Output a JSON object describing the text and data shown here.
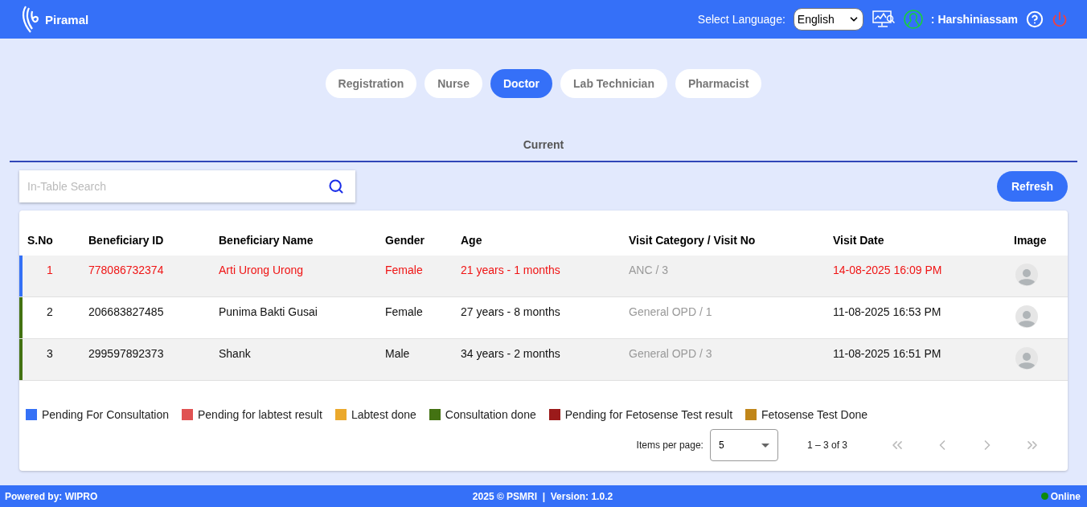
{
  "header": {
    "brand": "Piramal",
    "language_label": "Select Language:",
    "language": "English",
    "user_prefix": ":",
    "username": "Harshiniassam"
  },
  "role_tabs": [
    {
      "label": "Registration",
      "selected": false
    },
    {
      "label": "Nurse",
      "selected": false
    },
    {
      "label": "Doctor",
      "selected": true
    },
    {
      "label": "Lab Technician",
      "selected": false
    },
    {
      "label": "Pharmacist",
      "selected": false
    }
  ],
  "section_tab": {
    "label": "Current",
    "selected": true
  },
  "search": {
    "placeholder": "In-Table Search"
  },
  "refresh_button": "Refresh",
  "table": {
    "columns": [
      "S.No",
      "Beneficiary ID",
      "Beneficiary Name",
      "Gender",
      "Age",
      "Visit Category / Visit No",
      "Visit Date",
      "Image"
    ],
    "rows": [
      {
        "color": "#3571f6",
        "highlight": true,
        "sno": "1",
        "beneficiary_id": "778086732374",
        "name": "Arti Urong Urong",
        "gender": "Female",
        "age": "21 years - 1 months",
        "visit": "ANC / 3",
        "visit_date": "14-08-2025 16:09 PM"
      },
      {
        "color": "#437212",
        "highlight": false,
        "sno": "2",
        "beneficiary_id": "206683827485",
        "name": "Punima Bakti Gusai",
        "gender": "Female",
        "age": "27 years - 8 months",
        "visit": "General OPD / 1",
        "visit_date": "11-08-2025 16:53 PM"
      },
      {
        "color": "#437212",
        "highlight": false,
        "sno": "3",
        "beneficiary_id": "299597892373",
        "name": "Shank",
        "gender": "Male",
        "age": "34 years - 2 months",
        "visit": "General OPD / 3",
        "visit_date": "11-08-2025 16:51 PM"
      }
    ]
  },
  "legend": [
    {
      "label": "Pending For Consultation",
      "color": "#3571f6"
    },
    {
      "label": "Pending for labtest result",
      "color": "#e05252"
    },
    {
      "label": "Labtest done",
      "color": "#eba92c"
    },
    {
      "label": "Consultation done",
      "color": "#437212"
    },
    {
      "label": "Pending for Fetosense Test result",
      "color": "#9b1a1a"
    },
    {
      "label": "Fetosense Test Done",
      "color": "#c0861a"
    }
  ],
  "paginator": {
    "items_label": "Items per page:",
    "page_size": "5",
    "range": "1 – 3 of 3",
    "buttons": [
      {
        "kind": "first",
        "disabled": true
      },
      {
        "kind": "prev",
        "disabled": true
      },
      {
        "kind": "next",
        "disabled": true
      },
      {
        "kind": "last",
        "disabled": true
      }
    ]
  },
  "status_bar": {
    "powered_by": "Powered by: WIPRO",
    "copyright": "2025 © PSMRI  |  Version: 1.0.2",
    "status": "Online",
    "online": true
  }
}
